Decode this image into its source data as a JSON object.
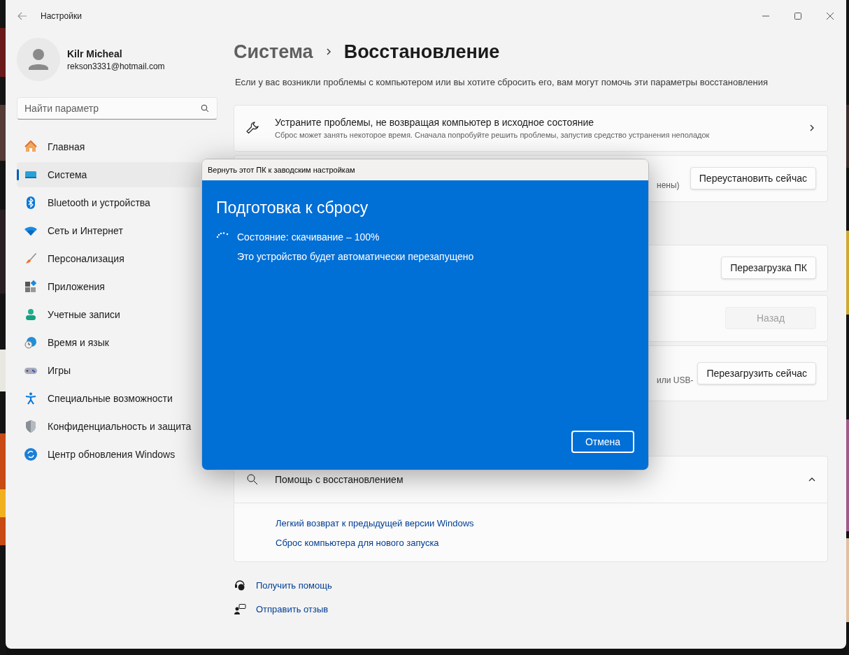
{
  "window": {
    "title": "Настройки"
  },
  "profile": {
    "name": "Kilr Micheal",
    "email": "rekson3331@hotmail.com"
  },
  "search": {
    "placeholder": "Найти параметр"
  },
  "nav": [
    {
      "label": "Главная",
      "selected": false
    },
    {
      "label": "Система",
      "selected": true
    },
    {
      "label": "Bluetooth и устройства",
      "selected": false
    },
    {
      "label": "Сеть и Интернет",
      "selected": false
    },
    {
      "label": "Персонализация",
      "selected": false
    },
    {
      "label": "Приложения",
      "selected": false
    },
    {
      "label": "Учетные записи",
      "selected": false
    },
    {
      "label": "Время и язык",
      "selected": false
    },
    {
      "label": "Игры",
      "selected": false
    },
    {
      "label": "Специальные возможности",
      "selected": false
    },
    {
      "label": "Конфиденциальность и защита",
      "selected": false
    },
    {
      "label": "Центр обновления Windows",
      "selected": false
    }
  ],
  "breadcrumb": {
    "parent": "Система",
    "current": "Восстановление"
  },
  "description": "Если у вас возникли проблемы с компьютером или вы хотите сбросить его, вам могут помочь эти параметры восстановления",
  "cards": [
    {
      "kind": "nav-row",
      "title": "Устраните проблемы, не возвращая компьютер в исходное состояние",
      "subtitle": "Сброс может занять некоторое время. Сначала попробуйте решить проблемы, запустив средство устранения неполадок"
    },
    {
      "kind": "button-row",
      "partial_text": "нены)",
      "button": {
        "label": "Переустановить сейчас",
        "disabled": false
      }
    },
    {
      "kind": "button-row",
      "button": {
        "label": "Перезагрузка ПК",
        "disabled": false
      }
    },
    {
      "kind": "button-row",
      "button": {
        "label": "Назад",
        "disabled": true
      }
    },
    {
      "kind": "button-row",
      "partial_text": "или USB-",
      "button": {
        "label": "Перезагрузить сейчас",
        "disabled": false
      }
    }
  ],
  "help_card": {
    "title": "Помощь с восстановлением",
    "expanded": true,
    "links": [
      "Легкий возврат к предыдущей версии Windows",
      "Сброс компьютера для нового запуска"
    ]
  },
  "footer_links": [
    "Получить помощь",
    "Отправить отзыв"
  ],
  "dialog": {
    "title": "Вернуть этот ПК к заводским настройкам",
    "heading": "Подготовка к сбросу",
    "status": "Состояние: скачивание – 100%",
    "note": "Это устройство будет автоматически перезапущено",
    "cancel": "Отмена"
  }
}
